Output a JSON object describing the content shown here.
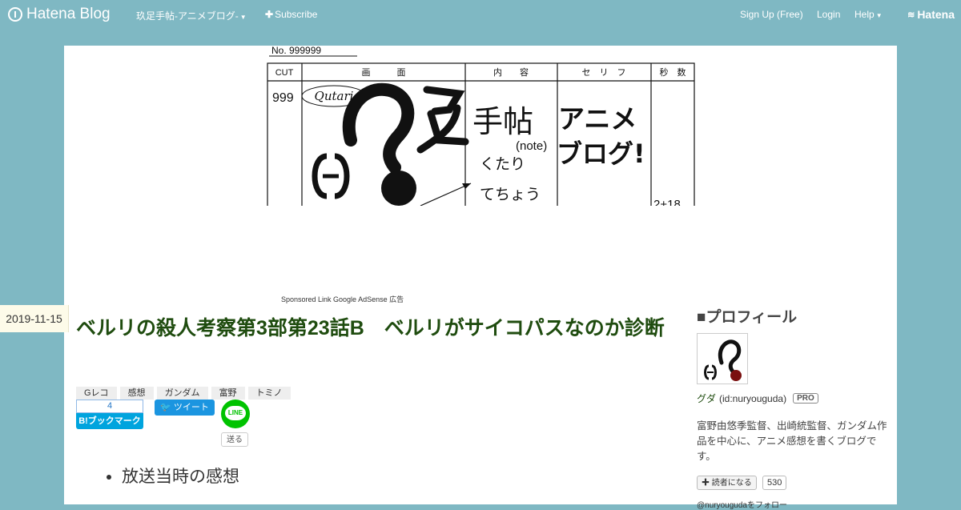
{
  "topbar": {
    "brand": "Hatena Blog",
    "blog_menu": "玖足手帖-アニメブログ-",
    "subscribe": "Subscribe",
    "signup": "Sign Up (Free)",
    "login": "Login",
    "help": "Help",
    "corp": "Hatena"
  },
  "banner": {
    "serial": "No. 999999",
    "headers": [
      "CUT",
      "画　　　面",
      "内　　容",
      "セ　リ　フ",
      "秒　数"
    ],
    "cut_no": "999",
    "qutari": "Qutari",
    "title_1": "手帖",
    "note": "(note)",
    "reading_1": "くたり",
    "reading_2": "てちょう",
    "anime_1": "アニメ",
    "anime_2": "ブログ!",
    "seconds": "2+18"
  },
  "sponsored": "Sponsored Link Google AdSense 広告",
  "entry": {
    "date": "2019-11-15",
    "title": "ベルリの殺人考察第3部第23話B　ベルリがサイコパスなのか診断",
    "tags": [
      "Gレコ",
      "感想",
      "ガンダム",
      "富野",
      "トミノ"
    ],
    "bookmark_count": "4",
    "bookmark_label": "B!ブックマーク",
    "tweet_label": "ツイート",
    "line_label": "LINE",
    "send_label": "送る",
    "list_items": [
      "放送当時の感想"
    ]
  },
  "sidebar": {
    "heading": "■プロフィール",
    "user_name": "グダ",
    "user_id": "(id:nuryouguda)",
    "pro": "PRO",
    "description": "富野由悠季監督、出崎統監督、ガンダム作品を中心に、アニメ感想を書くブログです。",
    "reader_button": "読者になる",
    "reader_count": "530",
    "follow_link": "@nuryougudaをフォロー"
  },
  "colors": {
    "background": "#7fb8c3",
    "title": "#1f4c0f",
    "hatebu": "#00a4de",
    "twitter": "#1b95e0",
    "line": "#00c300"
  }
}
